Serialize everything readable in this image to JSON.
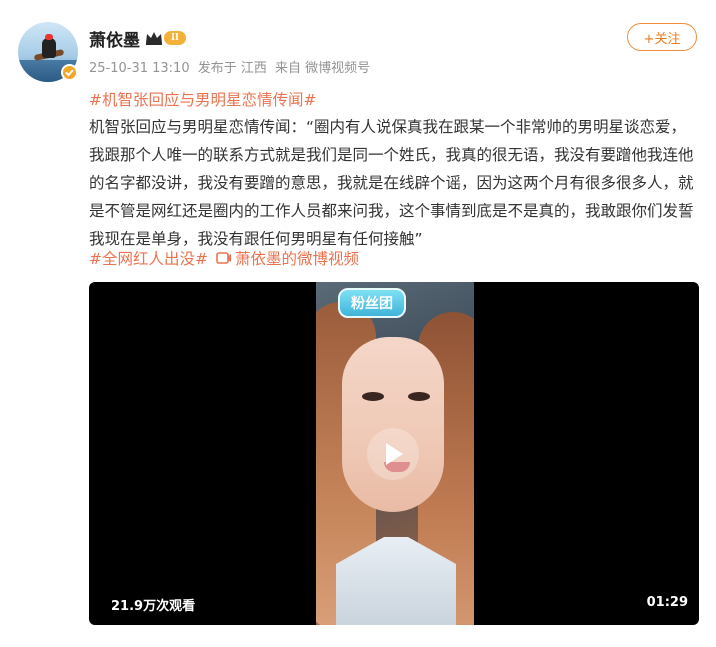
{
  "user": {
    "name": "萧依墨",
    "member_level": "II"
  },
  "meta": {
    "time": "25-10-31 13:10",
    "location": "发布于 江西",
    "source": "来自 微博视频号"
  },
  "follow_button": "+关注",
  "post": {
    "topic": "#机智张回应与男明星恋情传闻#",
    "text": "机智张回应与男明星恋情传闻：“圈内有人说保真我在跟某一个非常帅的男明星谈恋爱，我跟那个人唯一的联系方式就是我们是同一个姓氏，我真的很无语，我没有要蹭他我连他的名字都没讲，我没有要蹭的意思，我就是在线辟个谣，因为这两个月有很多很多人，就是不管是网红还是圈内的工作人员都来问我，这个事情到底是不是真的，我敢跟你们发誓我现在是单身，我没有跟任何男明星有任何接触”",
    "tag": "#全网红人出没#",
    "video_link": "萧依墨的微博视频"
  },
  "video": {
    "overlay_badge": "粉丝团",
    "views": "21.9万次观看",
    "duration": "01:29"
  },
  "colors": {
    "accent": "#eb7350",
    "follow": "#ef7b1d",
    "verified": "#f6a623"
  },
  "icons": [
    "verified-icon",
    "crown-icon",
    "video-icon",
    "play-icon"
  ]
}
